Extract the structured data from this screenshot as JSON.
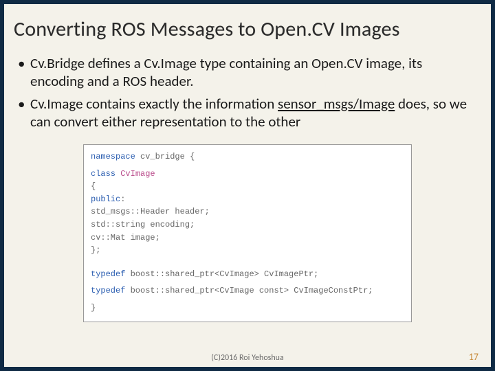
{
  "title": "Converting ROS Messages to Open.CV Images",
  "bullets": [
    {
      "pre": "Cv.Bridge defines a Cv.Image type containing an Open.CV image, its encoding and a ROS header."
    },
    {
      "pre": "Cv.Image contains exactly the information ",
      "link": "sensor_msgs/Image",
      "post": " does, so we can convert either representation to the other"
    }
  ],
  "code": {
    "ns_open_kw": "namespace ",
    "ns_open": "cv_bridge {",
    "class_kw": "class ",
    "class_name": "CvImage",
    "brace_open": "{",
    "public_kw": "public",
    "public_colon": ":",
    "m1": "  std_msgs::Header header;",
    "m2": "  std::string encoding;",
    "m3": "  cv::Mat image;",
    "brace_close": "};",
    "typedef_kw1": "typedef ",
    "typedef1": "boost::shared_ptr<CvImage> CvImagePtr;",
    "typedef_kw2": "typedef ",
    "typedef2": "boost::shared_ptr<CvImage const> CvImageConstPtr;",
    "ns_close": "}"
  },
  "footer": {
    "copyright": "(C)2016 Roi Yehoshua",
    "page": "17"
  }
}
